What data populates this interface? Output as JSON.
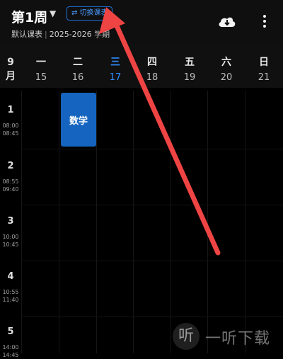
{
  "header": {
    "week_label": "第1周",
    "switch_label": "切换课表",
    "schedule_name": "默认课表",
    "term_text": "2025-2026 学期"
  },
  "days": {
    "month": "9\n月",
    "items": [
      {
        "name": "一",
        "date": "15"
      },
      {
        "name": "二",
        "date": "16"
      },
      {
        "name": "三",
        "date": "17",
        "today": true
      },
      {
        "name": "四",
        "date": "18"
      },
      {
        "name": "五",
        "date": "19"
      },
      {
        "name": "六",
        "date": "20"
      },
      {
        "name": "日",
        "date": "21"
      }
    ]
  },
  "periods": [
    {
      "num": "1",
      "start": "08:00",
      "end": "08:45"
    },
    {
      "num": "2",
      "start": "08:55",
      "end": "09:40"
    },
    {
      "num": "3",
      "start": "10:00",
      "end": "10:45"
    },
    {
      "num": "4",
      "start": "10:55",
      "end": "11:40"
    },
    {
      "num": "5",
      "start": "14:00",
      "end": "14:45"
    }
  ],
  "courses": [
    {
      "name": "数学",
      "day": "二",
      "period": "1"
    }
  ],
  "watermark": {
    "icon_text": "听",
    "text": "一听下载"
  },
  "colors": {
    "accent": "#1565c0",
    "today": "#2f8cff",
    "arrow": "#ef4444"
  }
}
